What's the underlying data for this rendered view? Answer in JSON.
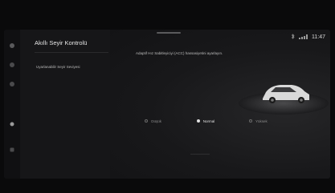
{
  "header": {
    "title": "Akıllı Seyir Kontrolü"
  },
  "status_bar": {
    "time": "11:47",
    "signal_icon": "signal-icon",
    "bluetooth_icon": "bluetooth-icon"
  },
  "nav_rail": {
    "icons": [
      "home-icon",
      "navigation-icon",
      "media-icon",
      "phone-icon",
      "settings-icon"
    ]
  },
  "menu": {
    "items": [
      {
        "label": "Uyarlanabilir Seyir Seviyesi",
        "selected": true
      }
    ]
  },
  "main": {
    "description": "Adaptif Hız Sabitleyiciyi (ACC) hassasiyetini ayarlayın.",
    "options": [
      {
        "label": "Düşük",
        "selected": false
      },
      {
        "label": "Normal",
        "selected": true
      },
      {
        "label": "Yüksek",
        "selected": false
      }
    ],
    "vehicle_image": "car-illustration"
  },
  "colors": {
    "background": "#0a0a0b",
    "panel": "#161618",
    "text": "#e6e6e6"
  }
}
